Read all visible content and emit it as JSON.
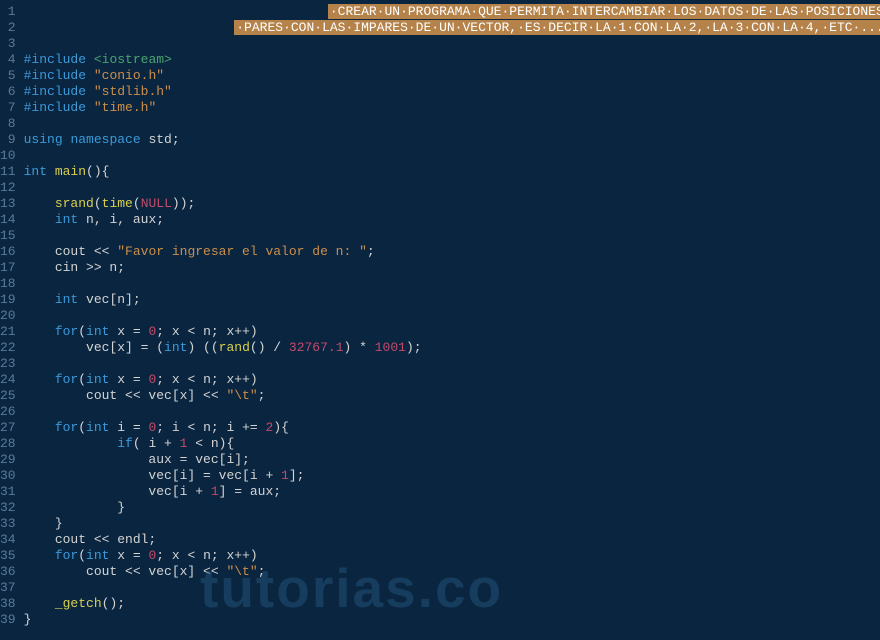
{
  "watermark": "tutorias.co",
  "lines": [
    {
      "n": 1,
      "html": "                                       <span class='highlight-band'>·CREAR·UN·PROGRAMA·QUE·PERMITA·INTERCAMBIAR·LOS·DATOS·DE·LAS·POSICIONES</span>"
    },
    {
      "n": 2,
      "html": "                           <span class='highlight-band'>·PARES·CON·LAS·IMPARES·DE·UN·VECTOR,·ES·DECIR·LA·1·CON·LA·2,·LA·3·CON·LA·4,·ETC·...</span>"
    },
    {
      "n": 3,
      "html": ""
    },
    {
      "n": 4,
      "html": "<span class='kw'>#include</span> <span class='inc'>&lt;iostream&gt;</span>"
    },
    {
      "n": 5,
      "html": "<span class='kw'>#include</span> <span class='str'>\"conio.h\"</span>"
    },
    {
      "n": 6,
      "html": "<span class='kw'>#include</span> <span class='str'>\"stdlib.h\"</span>"
    },
    {
      "n": 7,
      "html": "<span class='kw'>#include</span> <span class='str'>\"time.h\"</span>"
    },
    {
      "n": 8,
      "html": ""
    },
    {
      "n": 9,
      "html": "<span class='kw'>using</span> <span class='kw'>namespace</span> std;"
    },
    {
      "n": 10,
      "html": ""
    },
    {
      "n": 11,
      "html": "<span class='type'>int</span> <span class='fn'>main</span>(){"
    },
    {
      "n": 12,
      "html": ""
    },
    {
      "n": 13,
      "html": "    <span class='fn'>srand</span>(<span class='fn'>time</span>(<span class='num'>NULL</span>));"
    },
    {
      "n": 14,
      "html": "    <span class='type'>int</span> n, i, aux;"
    },
    {
      "n": 15,
      "html": ""
    },
    {
      "n": 16,
      "html": "    cout &lt;&lt; <span class='str'>\"Favor ingresar el valor de n: \"</span>;"
    },
    {
      "n": 17,
      "html": "    cin &gt;&gt; n;"
    },
    {
      "n": 18,
      "html": ""
    },
    {
      "n": 19,
      "html": "    <span class='type'>int</span> vec[n];"
    },
    {
      "n": 20,
      "html": ""
    },
    {
      "n": 21,
      "html": "    <span class='kw'>for</span>(<span class='type'>int</span> x = <span class='num'>0</span>; x &lt; n; x++)"
    },
    {
      "n": 22,
      "html": "        vec[x] = (<span class='type'>int</span>) ((<span class='fn'>rand</span>() / <span class='num'>32767.1</span>) * <span class='num'>1001</span>);"
    },
    {
      "n": 23,
      "html": ""
    },
    {
      "n": 24,
      "html": "    <span class='kw'>for</span>(<span class='type'>int</span> x = <span class='num'>0</span>; x &lt; n; x++)"
    },
    {
      "n": 25,
      "html": "        cout &lt;&lt; vec[x] &lt;&lt; <span class='str'>\"\\t\"</span>;"
    },
    {
      "n": 26,
      "html": ""
    },
    {
      "n": 27,
      "html": "    <span class='kw'>for</span>(<span class='type'>int</span> i = <span class='num'>0</span>; i &lt; n; i += <span class='num'>2</span>){"
    },
    {
      "n": 28,
      "html": "            <span class='kw'>if</span>( i + <span class='num'>1</span> &lt; n){"
    },
    {
      "n": 29,
      "html": "                aux = vec[i];"
    },
    {
      "n": 30,
      "html": "                vec[i] = vec[i + <span class='num'>1</span>];"
    },
    {
      "n": 31,
      "html": "                vec[i + <span class='num'>1</span>] = aux;"
    },
    {
      "n": 32,
      "html": "            }"
    },
    {
      "n": 33,
      "html": "    }"
    },
    {
      "n": 34,
      "html": "    cout &lt;&lt; endl;"
    },
    {
      "n": 35,
      "html": "    <span class='kw'>for</span>(<span class='type'>int</span> x = <span class='num'>0</span>; x &lt; n; x++)"
    },
    {
      "n": 36,
      "html": "        cout &lt;&lt; vec[x] &lt;&lt; <span class='str'>\"\\t\"</span>;"
    },
    {
      "n": 37,
      "html": ""
    },
    {
      "n": 38,
      "html": "    <span class='fn'>_getch</span>();"
    },
    {
      "n": 39,
      "html": "}"
    }
  ]
}
